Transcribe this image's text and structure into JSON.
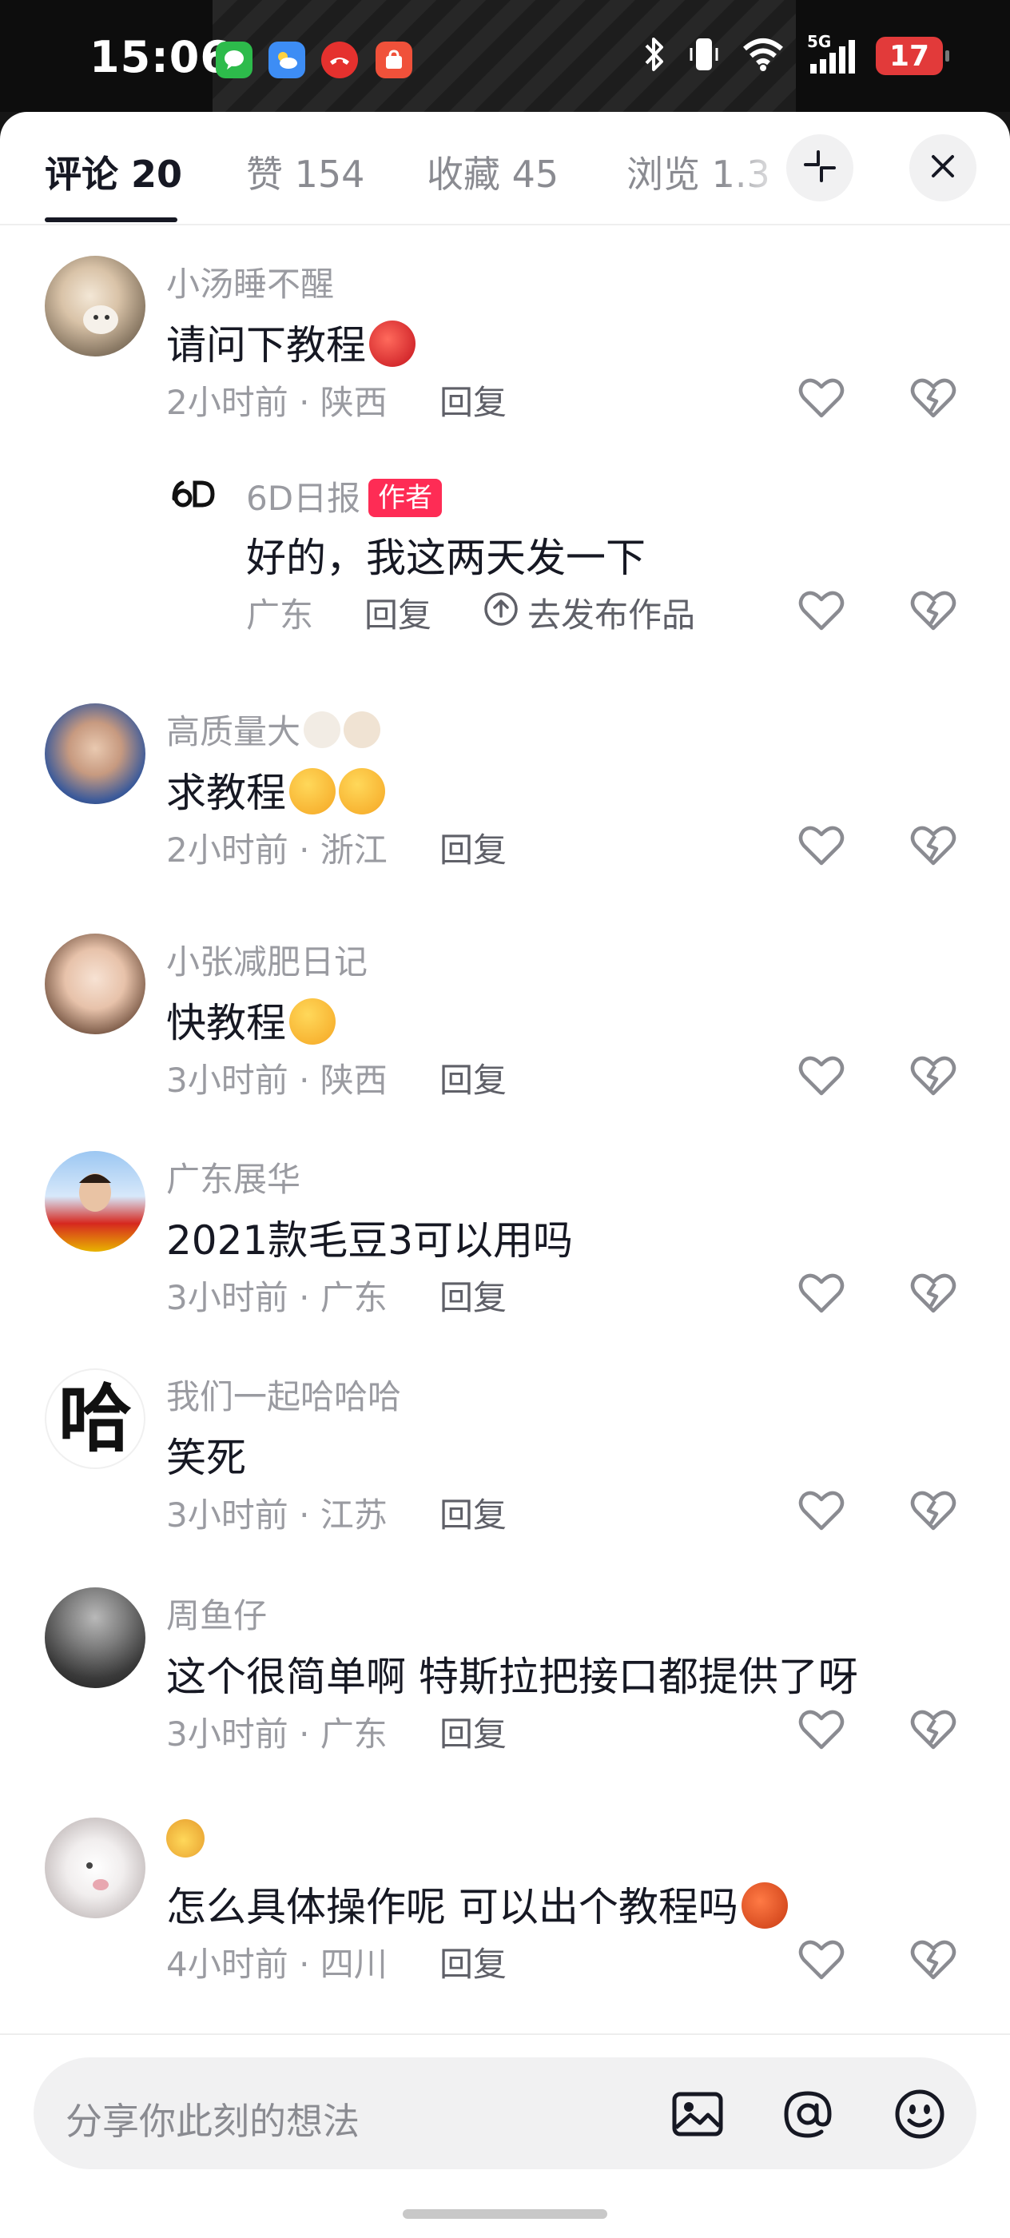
{
  "status_bar": {
    "time": "15:06",
    "network": "5G",
    "battery": "17"
  },
  "tabs": [
    {
      "label": "评论 20",
      "active": true
    },
    {
      "label": "赞 154",
      "active": false
    },
    {
      "label": "收藏 45",
      "active": false
    },
    {
      "label": "浏览 1.3",
      "active": false
    }
  ],
  "reply_label": "回复",
  "comments": [
    {
      "author": "小汤睡不醒",
      "text": "请问下教程",
      "meta": "2小时前 · 陕西",
      "emoji": "spider-ball"
    },
    {
      "author": "6D日报",
      "badge": "作者",
      "text": "好的，我这两天发一下",
      "meta": "广东",
      "action": "去发布作品"
    },
    {
      "author": "高质量大",
      "text": "求教程",
      "meta": "2小时前 · 浙江",
      "emoji": "heart-eyes"
    },
    {
      "author": "小张减肥日记",
      "text": "快教程",
      "meta": "3小时前 · 陕西",
      "emoji": "thinking"
    },
    {
      "author": "广东展华",
      "text": "2021款毛豆3可以用吗",
      "meta": "3小时前 · 广东"
    },
    {
      "author": "我们一起哈哈哈",
      "avatar_char": "哈",
      "text": "笑死",
      "meta": "3小时前 · 江苏"
    },
    {
      "author": "周鱼仔",
      "text": "这个很简单啊 特斯拉把接口都提供了呀",
      "meta": "3小时前 · 广东"
    },
    {
      "author": "",
      "text": "怎么具体操作呢 可以出个教程吗",
      "meta": "4小时前 · 四川",
      "emoji": "basketball"
    }
  ],
  "input": {
    "placeholder": "分享你此刻的想法"
  },
  "colors": {
    "accent": "#fe2c55",
    "text_primary": "#161823",
    "text_secondary": "#9a9ba1",
    "sheet_bg": "#ffffff"
  },
  "icons": [
    "collapse-icon",
    "close-icon",
    "heart-icon",
    "dislike-icon",
    "image-icon",
    "at-icon",
    "emoji-icon",
    "upload-icon"
  ]
}
